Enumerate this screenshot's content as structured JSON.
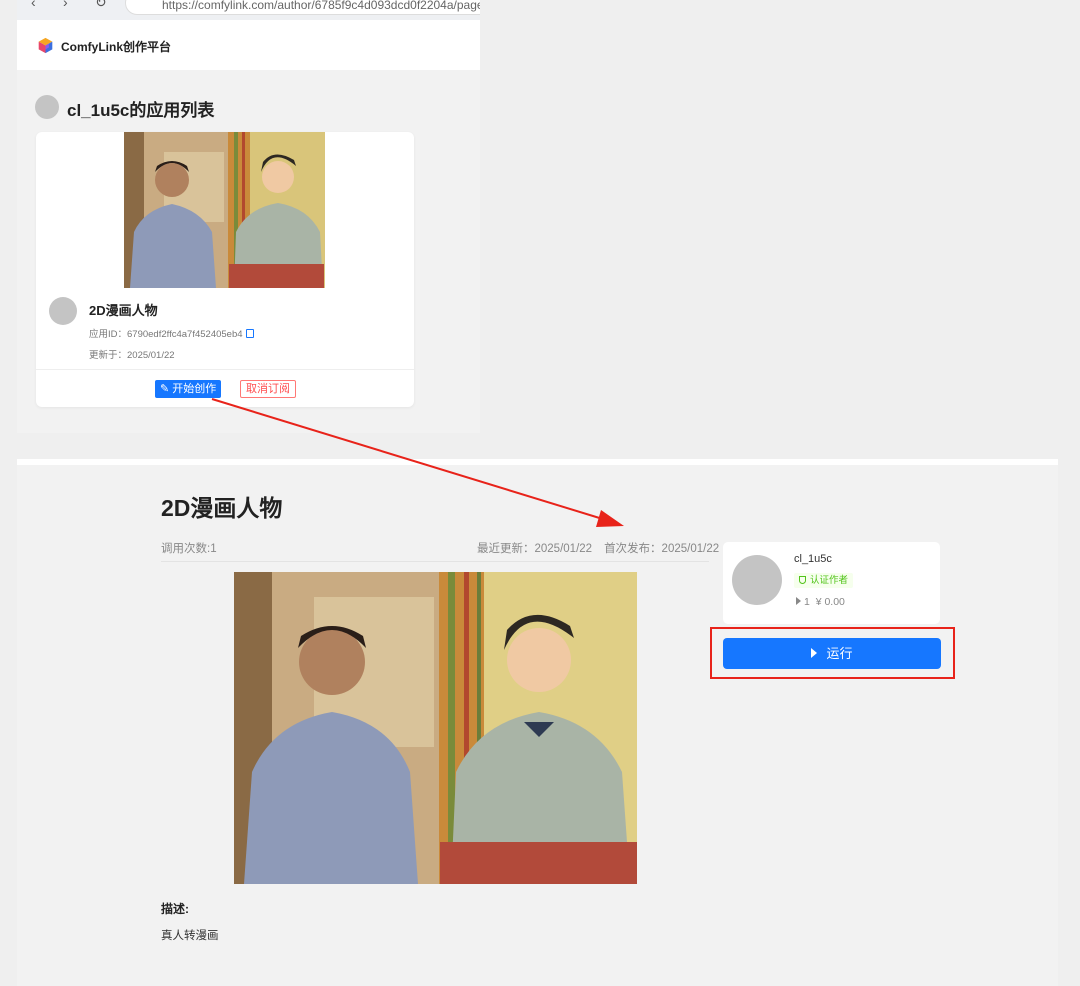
{
  "browser": {
    "url": "https://comfylink.com/author/6785f9c4d093dcd0f2204a/page"
  },
  "top_page": {
    "brand": "ComfyLink创作平台",
    "author_list_title": "cl_1u5c的应用列表",
    "card": {
      "app_name": "2D漫画人物",
      "app_id": "应用ID：6790edf2ffc4a7f452405eb4",
      "updated": "更新于：2025/01/22",
      "start_button": "开始创作",
      "unsubscribe_button": "取消订阅"
    }
  },
  "detail_page": {
    "title": "2D漫画人物",
    "usage_count": "调用次数:1",
    "last_updated": "最近更新：2025/01/22",
    "first_published": "首次发布：2025/01/22",
    "description_label": "描述:",
    "description": "真人转漫画",
    "author": {
      "name": "cl_1u5c",
      "badge": "认证作者",
      "runs": "1",
      "price": "¥ 0.00"
    },
    "run_button": "运行"
  },
  "colors": {
    "primary": "#1677ff",
    "danger": "#ff4d4f",
    "highlight": "#e8231a",
    "verified": "#52c41a"
  },
  "icons": [
    "logo-cube-icon",
    "copy-icon",
    "edit-pen-icon",
    "shield-check-icon",
    "play-icon"
  ]
}
